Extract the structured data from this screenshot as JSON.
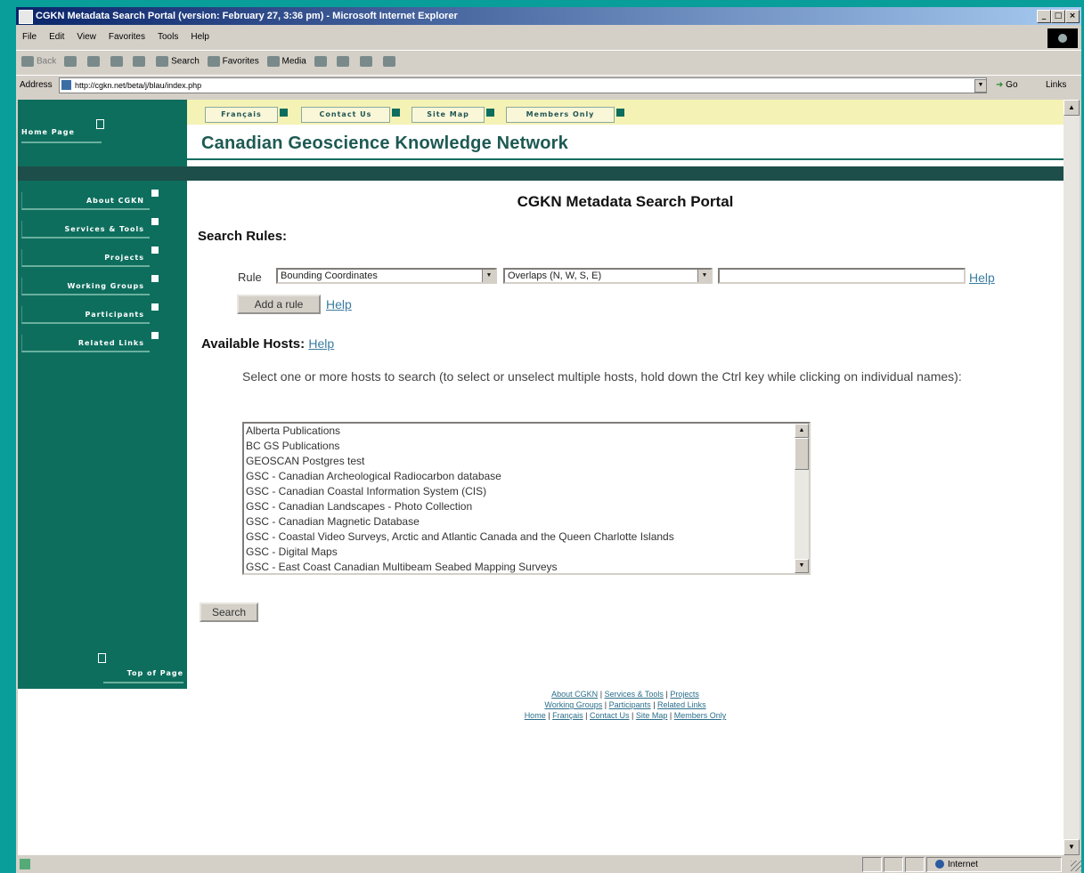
{
  "window": {
    "title": "CGKN Metadata Search Portal (version: February 27, 3:36 pm) - Microsoft Internet Explorer",
    "controls": [
      "_",
      "□",
      "×"
    ]
  },
  "menubar": [
    "File",
    "Edit",
    "View",
    "Favorites",
    "Tools",
    "Help"
  ],
  "toolbar": {
    "back": "Back",
    "search": "Search",
    "favorites": "Favorites",
    "media": "Media"
  },
  "address": {
    "label": "Address",
    "url": "http://cgkn.net/beta/j/blau/index.php",
    "go": "Go",
    "links": "Links"
  },
  "statusbar": {
    "zone": "Internet"
  },
  "site": {
    "home": "Home Page",
    "title": "Canadian Geoscience Knowledge Network",
    "topnav": [
      "Français",
      "Contact Us",
      "Site Map",
      "Members Only"
    ],
    "sidenav": [
      "About CGKN",
      "Services & Tools",
      "Projects",
      "Working Groups",
      "Participants",
      "Related Links"
    ],
    "top_of_page": "Top of Page"
  },
  "main": {
    "heading": "CGKN Metadata Search Portal",
    "search_rules_label": "Search Rules:",
    "rule_label": "Rule",
    "rule_field": "Bounding Coordinates",
    "rule_operator": "Overlaps (N, W, S, E)",
    "rule_value": "",
    "help": "Help",
    "add_rule": "Add a rule",
    "available_hosts_label": "Available Hosts:",
    "hosts_instructions": "Select one or more hosts to search (to select or unselect multiple hosts, hold down the Ctrl key while clicking on individual names):",
    "hosts": [
      "Alberta Publications",
      "BC GS Publications",
      "GEOSCAN Postgres test",
      "GSC - Canadian Archeological Radiocarbon database",
      "GSC - Canadian Coastal Information System (CIS)",
      "GSC - Canadian Landscapes - Photo Collection",
      "GSC - Canadian Magnetic Database",
      "GSC - Coastal Video Surveys, Arctic and Atlantic Canada and the Queen Charlotte Islands",
      "GSC - Digital Maps",
      "GSC - East Coast Canadian Multibeam Seabed Mapping Surveys"
    ],
    "search_button": "Search"
  },
  "footer": {
    "line1": [
      "About CGKN",
      "Services & Tools",
      "Projects"
    ],
    "line2": [
      "Working Groups",
      "Participants",
      "Related Links"
    ],
    "line3": [
      "Home",
      "Français",
      "Contact Us",
      "Site Map",
      "Members Only"
    ]
  }
}
